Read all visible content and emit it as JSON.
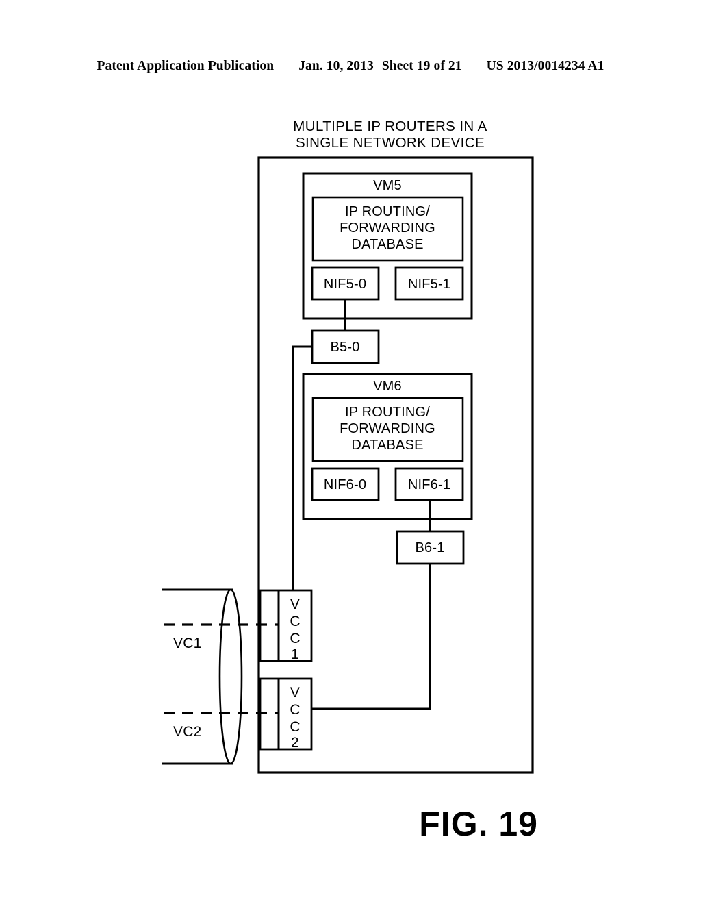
{
  "header": {
    "publication": "Patent Application Publication",
    "date": "Jan. 10, 2013",
    "sheet": "Sheet 19 of 21",
    "number": "US 2013/0014234 A1"
  },
  "figure": {
    "label": "FIG. 19",
    "title_line1": "MULTIPLE IP ROUTERS IN A",
    "title_line2": "SINGLE NETWORK DEVICE"
  },
  "device": {
    "name": "network-device-boundary",
    "vms": [
      {
        "label": "VM5",
        "database": {
          "line1": "IP ROUTING/",
          "line2": "FORWARDING",
          "line3": "DATABASE"
        },
        "interfaces": [
          {
            "label": "NIF5-0"
          },
          {
            "label": "NIF5-1"
          }
        ]
      },
      {
        "label": "VM6",
        "database": {
          "line1": "IP ROUTING/",
          "line2": "FORWARDING",
          "line3": "DATABASE"
        },
        "interfaces": [
          {
            "label": "NIF6-0"
          },
          {
            "label": "NIF6-1"
          }
        ]
      }
    ],
    "bridges": [
      {
        "label": "B5-0"
      },
      {
        "label": "B6-1"
      }
    ],
    "vcc_ports": [
      {
        "chars": [
          "V",
          "C",
          "C",
          "1"
        ]
      },
      {
        "chars": [
          "V",
          "C",
          "C",
          "2"
        ]
      }
    ]
  },
  "virtual_circuits": [
    {
      "label": "VC1"
    },
    {
      "label": "VC2"
    }
  ],
  "colors": {
    "line": "#000000",
    "background": "#ffffff"
  }
}
